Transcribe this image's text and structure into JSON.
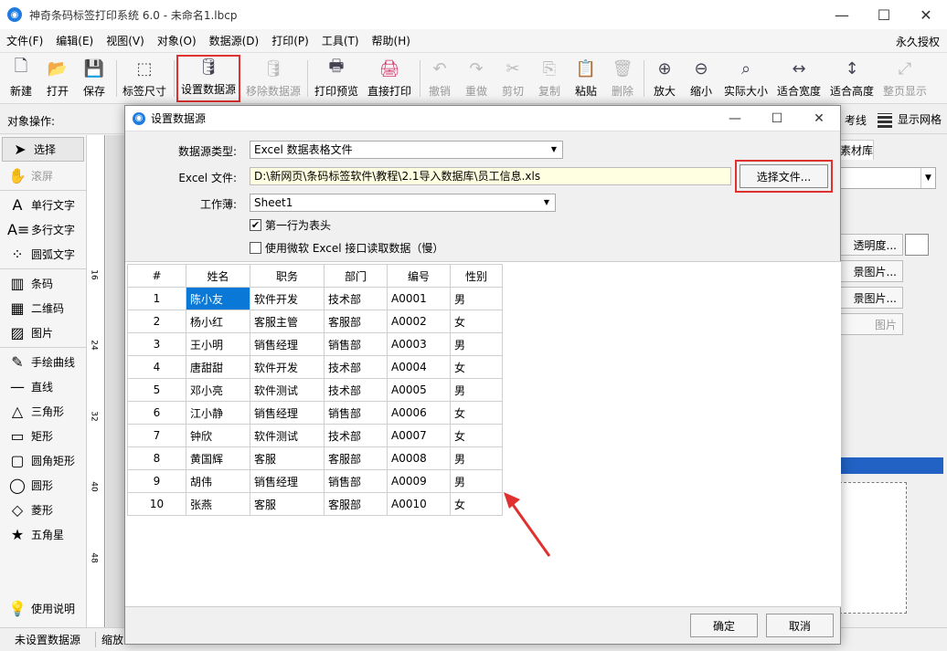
{
  "window": {
    "title": "神奇条码标签打印系统 6.0 - 未命名1.lbcp",
    "minimize": "—",
    "maximize": "☐",
    "close": "✕"
  },
  "menu": {
    "items": [
      "文件(F)",
      "编辑(E)",
      "视图(V)",
      "对象(O)",
      "数据源(D)",
      "打印(P)",
      "工具(T)",
      "帮助(H)"
    ],
    "license": "永久授权"
  },
  "toolbar": [
    {
      "label": "新建",
      "icon": "new-file-icon",
      "glyph": "🗋"
    },
    {
      "label": "打开",
      "icon": "open-icon",
      "glyph": "📂"
    },
    {
      "label": "保存",
      "icon": "save-icon",
      "glyph": "💾"
    },
    {
      "label": "标签尺寸",
      "icon": "label-size-icon",
      "glyph": "⬚"
    },
    {
      "label": "设置数据源",
      "icon": "database-set-icon",
      "glyph": "🛢"
    },
    {
      "label": "移除数据源",
      "icon": "database-remove-icon",
      "glyph": "🛢"
    },
    {
      "label": "打印预览",
      "icon": "print-preview-icon",
      "glyph": "🖶"
    },
    {
      "label": "直接打印",
      "icon": "print-icon",
      "glyph": "🖨"
    },
    {
      "label": "撤销",
      "icon": "undo-icon",
      "glyph": "↶"
    },
    {
      "label": "重做",
      "icon": "redo-icon",
      "glyph": "↷"
    },
    {
      "label": "剪切",
      "icon": "cut-icon",
      "glyph": "✂"
    },
    {
      "label": "复制",
      "icon": "copy-icon",
      "glyph": "⎘"
    },
    {
      "label": "粘贴",
      "icon": "paste-icon",
      "glyph": "📋"
    },
    {
      "label": "删除",
      "icon": "delete-icon",
      "glyph": "🗑"
    },
    {
      "label": "放大",
      "icon": "zoom-in-icon",
      "glyph": "⊕"
    },
    {
      "label": "缩小",
      "icon": "zoom-out-icon",
      "glyph": "⊖"
    },
    {
      "label": "实际大小",
      "icon": "actual-size-icon",
      "glyph": "⌕"
    },
    {
      "label": "适合宽度",
      "icon": "fit-width-icon",
      "glyph": "↔"
    },
    {
      "label": "适合高度",
      "icon": "fit-height-icon",
      "glyph": "↕"
    },
    {
      "label": "整页显示",
      "icon": "fit-page-icon",
      "glyph": "⤢"
    }
  ],
  "objbar": {
    "label": "对象操作:",
    "guide": "考线",
    "show_grid": "显示网格"
  },
  "left_tools": [
    {
      "label": "选择",
      "icon": "cursor-icon",
      "glyph": "➤"
    },
    {
      "label": "滚屏",
      "icon": "hand-icon",
      "glyph": "✋"
    },
    {
      "label": "单行文字",
      "icon": "single-text-icon",
      "glyph": "A"
    },
    {
      "label": "多行文字",
      "icon": "multi-text-icon",
      "glyph": "A≡"
    },
    {
      "label": "圆弧文字",
      "icon": "arc-text-icon",
      "glyph": "⁘"
    },
    {
      "label": "条码",
      "icon": "barcode-icon",
      "glyph": "▥"
    },
    {
      "label": "二维码",
      "icon": "qrcode-icon",
      "glyph": "▦"
    },
    {
      "label": "图片",
      "icon": "image-icon",
      "glyph": "▨"
    },
    {
      "label": "手绘曲线",
      "icon": "pen-icon",
      "glyph": "✎"
    },
    {
      "label": "直线",
      "icon": "line-icon",
      "glyph": "—"
    },
    {
      "label": "三角形",
      "icon": "triangle-icon",
      "glyph": "△"
    },
    {
      "label": "矩形",
      "icon": "rect-icon",
      "glyph": "▭"
    },
    {
      "label": "圆角矩形",
      "icon": "round-rect-icon",
      "glyph": "▢"
    },
    {
      "label": "圆形",
      "icon": "circle-icon",
      "glyph": "◯"
    },
    {
      "label": "菱形",
      "icon": "diamond-icon",
      "glyph": "◇"
    },
    {
      "label": "五角星",
      "icon": "star-icon",
      "glyph": "★"
    }
  ],
  "help": {
    "label": "使用说明",
    "glyph": "💡"
  },
  "ruler": [
    "16",
    "24",
    "32",
    "40",
    "48"
  ],
  "right_panel": {
    "tab": "素材库",
    "btn_transparency": "透明度...",
    "btn_img1": "景图片...",
    "btn_img2": "景图片...",
    "btn_img3": "图片"
  },
  "status": {
    "datasource": "未设置数据源",
    "zoom": "缩放"
  },
  "dialog": {
    "title": "设置数据源",
    "type_label": "数据源类型:",
    "type_value": "Excel 数据表格文件",
    "file_label": "Excel 文件:",
    "file_value": "D:\\新网页\\条码标签软件\\教程\\2.1导入数据库\\员工信息.xls",
    "choose_btn": "选择文件...",
    "sheet_label": "工作薄:",
    "sheet_value": "Sheet1",
    "chk_header": "第一行为表头",
    "chk_ms": "使用微软 Excel 接口读取数据（慢）",
    "ok": "确定",
    "cancel": "取消",
    "table": {
      "columns": [
        "#",
        "姓名",
        "职务",
        "部门",
        "编号",
        "性别"
      ],
      "rows": [
        [
          "1",
          "陈小友",
          "软件开发",
          "技术部",
          "A0001",
          "男"
        ],
        [
          "2",
          "杨小红",
          "客服主管",
          "客服部",
          "A0002",
          "女"
        ],
        [
          "3",
          "王小明",
          "销售经理",
          "销售部",
          "A0003",
          "男"
        ],
        [
          "4",
          "唐甜甜",
          "软件开发",
          "技术部",
          "A0004",
          "女"
        ],
        [
          "5",
          "邓小亮",
          "软件测试",
          "技术部",
          "A0005",
          "男"
        ],
        [
          "6",
          "江小静",
          "销售经理",
          "销售部",
          "A0006",
          "女"
        ],
        [
          "7",
          "钟欣",
          "软件测试",
          "技术部",
          "A0007",
          "女"
        ],
        [
          "8",
          "黄国辉",
          "客服",
          "客服部",
          "A0008",
          "男"
        ],
        [
          "9",
          "胡伟",
          "销售经理",
          "销售部",
          "A0009",
          "男"
        ],
        [
          "10",
          "张燕",
          "客服",
          "客服部",
          "A0010",
          "女"
        ]
      ]
    }
  },
  "colors": {
    "highlight": "#e03131",
    "selection": "#0a78d7",
    "accent": "#2162c4"
  }
}
